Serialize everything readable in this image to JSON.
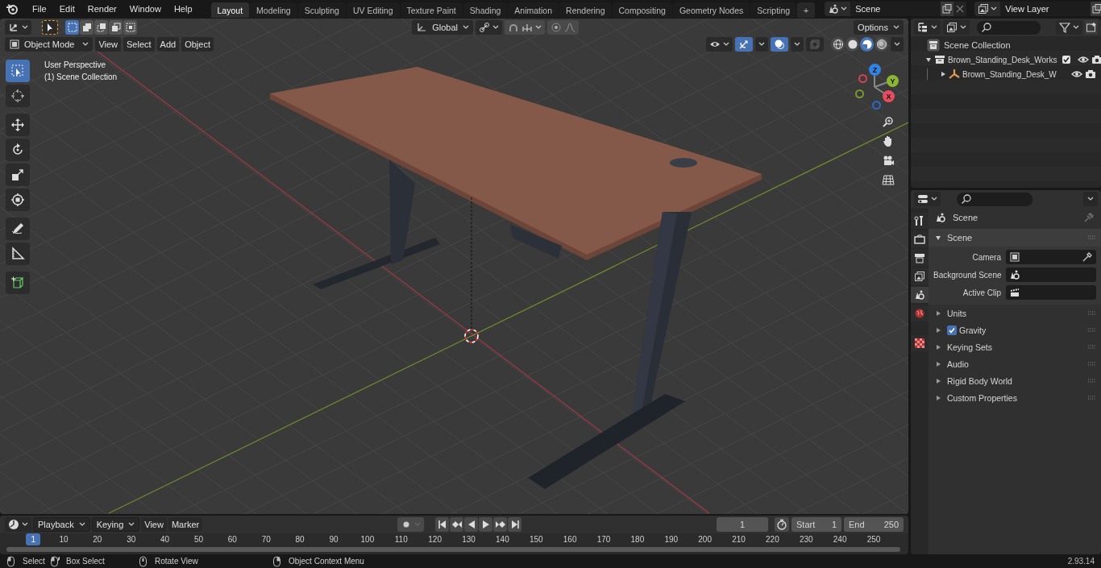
{
  "menu": [
    "File",
    "Edit",
    "Render",
    "Window",
    "Help"
  ],
  "workspace_tabs": [
    {
      "label": "Layout",
      "selected": true
    },
    {
      "label": "Modeling",
      "selected": false
    },
    {
      "label": "Sculpting",
      "selected": false
    },
    {
      "label": "UV Editing",
      "selected": false
    },
    {
      "label": "Texture Paint",
      "selected": false
    },
    {
      "label": "Shading",
      "selected": false
    },
    {
      "label": "Animation",
      "selected": false
    },
    {
      "label": "Rendering",
      "selected": false
    },
    {
      "label": "Compositing",
      "selected": false
    },
    {
      "label": "Geometry Nodes",
      "selected": false
    },
    {
      "label": "Scripting",
      "selected": false
    }
  ],
  "add_tab": "+",
  "scene": {
    "value": "Scene"
  },
  "view_layer": {
    "value": "View Layer"
  },
  "viewport": {
    "select_modes": [
      {
        "kind": "new",
        "selected": true
      },
      {
        "kind": "extend",
        "selected": false
      },
      {
        "kind": "subtract",
        "selected": false
      },
      {
        "kind": "invert",
        "selected": false
      },
      {
        "kind": "intersect",
        "selected": false
      }
    ],
    "orientation": "Global",
    "snap_on": false,
    "proportional_on": false,
    "options": "Options",
    "mode": "Object Mode",
    "menus": [
      "View",
      "Select",
      "Add",
      "Object"
    ],
    "gizmos_on": true,
    "overlays_on": true,
    "shading": [
      {
        "kind": "wireframe",
        "selected": false
      },
      {
        "kind": "solid",
        "selected": false
      },
      {
        "kind": "material",
        "selected": true
      },
      {
        "kind": "rendered",
        "selected": false
      }
    ],
    "info": [
      "User Perspective",
      "(1) Scene Collection"
    ],
    "tools": [
      {
        "kind": "select",
        "selected": true
      },
      {
        "kind": "cursor",
        "selected": false
      },
      {
        "kind": "move",
        "selected": false
      },
      {
        "kind": "rotate",
        "selected": false
      },
      {
        "kind": "scale",
        "selected": false
      },
      {
        "kind": "transform",
        "selected": false
      },
      {
        "kind": "annotate",
        "selected": false
      },
      {
        "kind": "measure",
        "selected": false
      },
      {
        "kind": "add_cube",
        "selected": false
      }
    ],
    "axes": [
      "Z",
      "Y",
      "X"
    ]
  },
  "outliner": {
    "root": "Scene Collection",
    "items": [
      {
        "name": "Brown_Standing_Desk_Works",
        "expanded": true,
        "checked": true,
        "children": [
          {
            "name": "Brown_Standing_Desk_W",
            "expanded": false
          }
        ]
      }
    ]
  },
  "properties": {
    "tabs": [
      {
        "kind": "tool",
        "selected": false
      },
      {
        "kind": "render",
        "selected": false
      },
      {
        "kind": "output",
        "selected": false
      },
      {
        "kind": "view_layer",
        "selected": false
      },
      {
        "kind": "scene",
        "selected": true
      },
      {
        "kind": "world",
        "selected": false
      },
      {
        "kind": "texture",
        "selected": false
      }
    ],
    "context": "Scene",
    "panel": {
      "title": "Scene",
      "expanded": true,
      "fields": [
        {
          "label": "Camera",
          "kind": "camera"
        },
        {
          "label": "Background Scene",
          "kind": "scene"
        },
        {
          "label": "Active Clip",
          "kind": "clip"
        }
      ]
    },
    "subpanels": [
      {
        "label": "Units",
        "kind": "plain",
        "expanded": false
      },
      {
        "label": "Gravity",
        "kind": "toggle",
        "expanded": false,
        "checked": true
      },
      {
        "label": "Keying Sets",
        "kind": "plain",
        "expanded": false
      },
      {
        "label": "Audio",
        "kind": "plain",
        "expanded": false
      },
      {
        "label": "Rigid Body World",
        "kind": "plain",
        "expanded": false
      },
      {
        "label": "Custom Properties",
        "kind": "plain",
        "expanded": false
      }
    ]
  },
  "timeline": {
    "menus": [
      {
        "label": "Playback",
        "dropdown": true
      },
      {
        "label": "Keying",
        "dropdown": true
      },
      {
        "label": "View",
        "dropdown": false
      },
      {
        "label": "Marker",
        "dropdown": false
      }
    ],
    "current_frame": "1",
    "start_label": "Start",
    "start": "1",
    "end_label": "End",
    "end": "250",
    "playhead": "1",
    "ticks": [
      "10",
      "20",
      "30",
      "40",
      "50",
      "60",
      "70",
      "80",
      "90",
      "100",
      "110",
      "120",
      "130",
      "140",
      "150",
      "160",
      "170",
      "180",
      "190",
      "200",
      "210",
      "220",
      "230",
      "240",
      "250"
    ]
  },
  "status_bar": {
    "items": [
      {
        "label": "Select",
        "kind": "left"
      },
      {
        "label": "Box Select",
        "kind": "drag"
      },
      {
        "label": "Rotate View",
        "kind": "middle"
      },
      {
        "label": "Object Context Menu",
        "kind": "right"
      }
    ],
    "version": "2.93.14"
  }
}
